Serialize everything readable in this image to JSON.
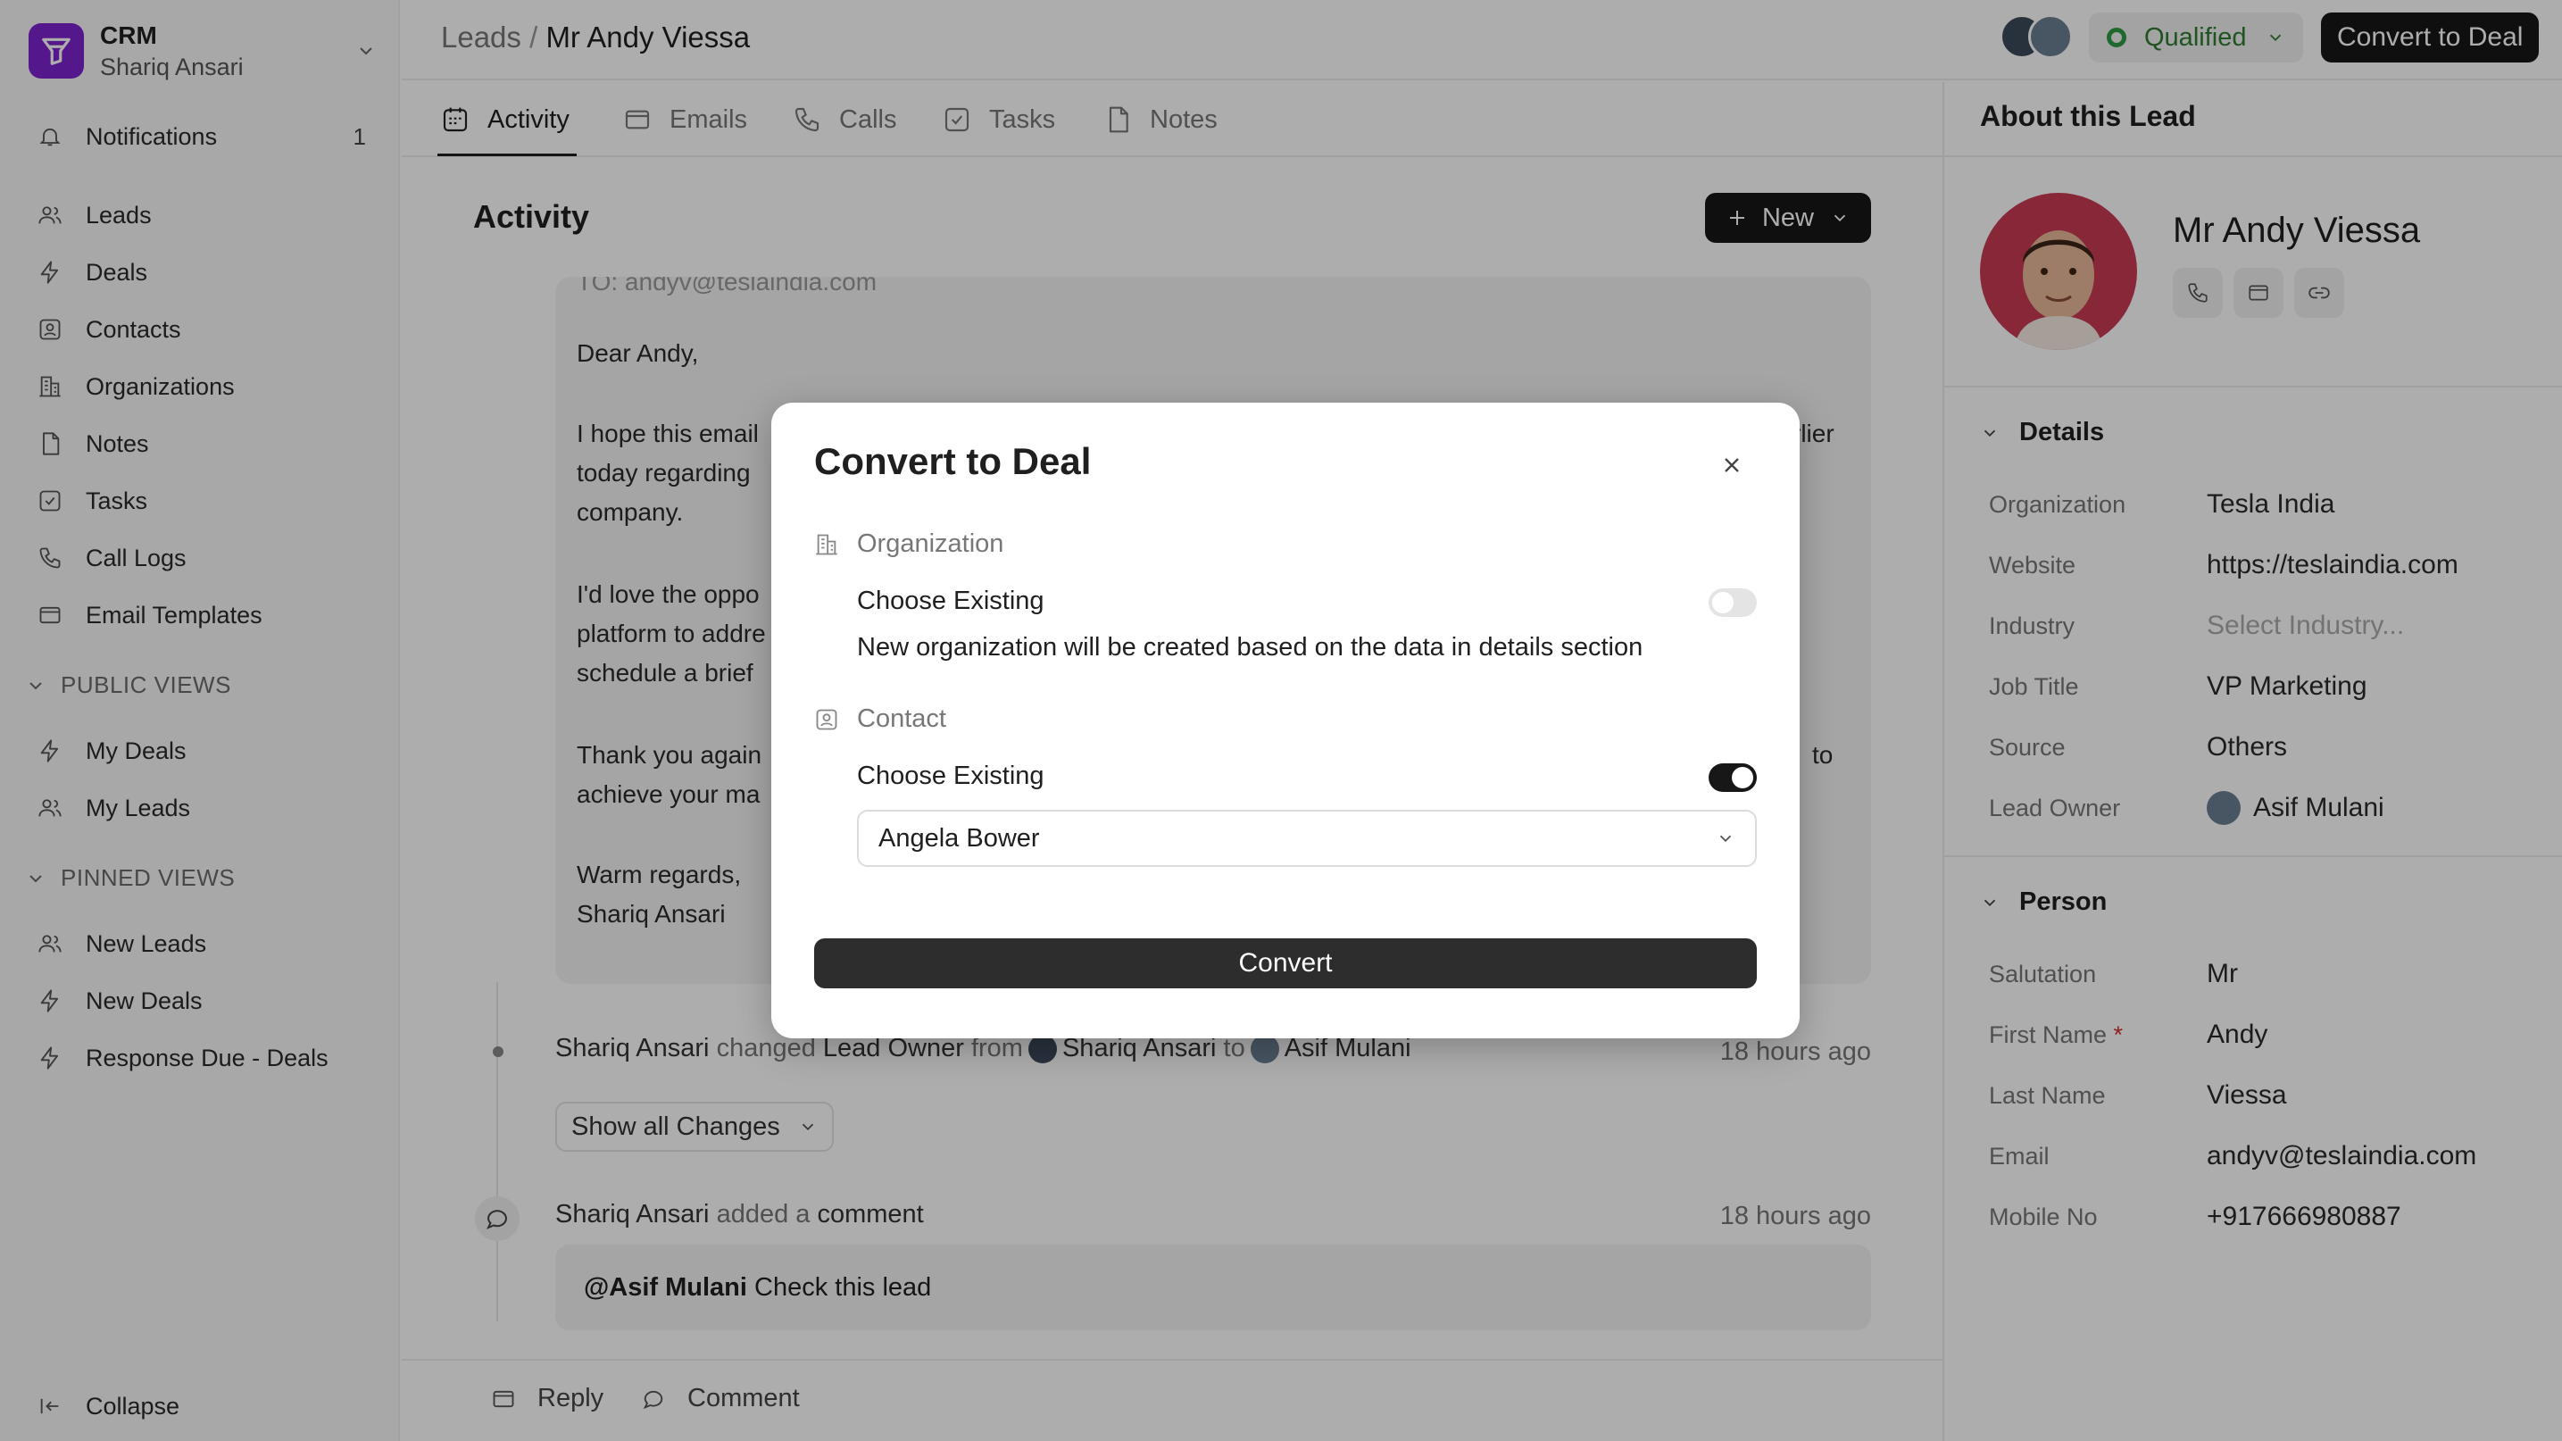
{
  "app": {
    "name": "CRM",
    "user": "Shariq Ansari"
  },
  "sidebar": {
    "notifications": {
      "label": "Notifications",
      "count": "1"
    },
    "items": [
      {
        "label": "Leads",
        "icon": "users-icon"
      },
      {
        "label": "Deals",
        "icon": "bolt-icon"
      },
      {
        "label": "Contacts",
        "icon": "contact-icon"
      },
      {
        "label": "Organizations",
        "icon": "building-icon"
      },
      {
        "label": "Notes",
        "icon": "note-icon"
      },
      {
        "label": "Tasks",
        "icon": "checkbox-icon"
      },
      {
        "label": "Call Logs",
        "icon": "phone-icon"
      },
      {
        "label": "Email Templates",
        "icon": "mail-icon"
      }
    ],
    "public_views": {
      "title": "PUBLIC VIEWS",
      "items": [
        "My Deals",
        "My Leads"
      ]
    },
    "pinned_views": {
      "title": "PINNED VIEWS",
      "items": [
        "New Leads",
        "New Deals",
        "Response Due - Deals"
      ]
    },
    "collapse": "Collapse"
  },
  "header": {
    "breadcrumb_parent": "Leads",
    "breadcrumb_sep": "/",
    "breadcrumb_current": "Mr Andy Viessa",
    "status": "Qualified",
    "convert_label": "Convert to Deal"
  },
  "tabs": [
    {
      "label": "Activity",
      "active": true
    },
    {
      "label": "Emails"
    },
    {
      "label": "Calls"
    },
    {
      "label": "Tasks"
    },
    {
      "label": "Notes"
    }
  ],
  "activity": {
    "title": "Activity",
    "new_label": "New",
    "email": {
      "to": "TO: andyv@teslaindia.com",
      "lines": [
        "Dear Andy,",
        "I hope this email",
        "today regarding",
        "company.",
        "I'd love the oppo",
        "platform to addre",
        "schedule a brief",
        "Thank you again",
        "achieve your ma",
        "Warm regards,",
        "Shariq Ansari"
      ],
      "right_fragments": [
        "rlier",
        "to"
      ]
    },
    "change": {
      "actor": "Shariq Ansari",
      "verb": "changed",
      "field": "Lead Owner",
      "from_word": "from",
      "from_user": "Shariq Ansari",
      "to_word": "to",
      "to_user": "Asif Mulani",
      "time": "18 hours ago",
      "show_changes": "Show all Changes"
    },
    "comment": {
      "actor": "Shariq Ansari",
      "verb": "added a",
      "noun": "comment",
      "time": "18 hours ago",
      "mention": "@Asif Mulani",
      "text": "Check this lead"
    }
  },
  "footer": {
    "reply": "Reply",
    "comment": "Comment"
  },
  "right_panel": {
    "title": "About this Lead",
    "name": "Mr Andy Viessa",
    "details": {
      "title": "Details",
      "fields": [
        {
          "label": "Organization",
          "value": "Tesla India"
        },
        {
          "label": "Website",
          "value": "https://teslaindia.com"
        },
        {
          "label": "Industry",
          "value": "Select Industry..."
        },
        {
          "label": "Job Title",
          "value": "VP Marketing"
        },
        {
          "label": "Source",
          "value": "Others"
        },
        {
          "label": "Lead Owner",
          "value": "Asif Mulani"
        }
      ]
    },
    "person": {
      "title": "Person",
      "fields": [
        {
          "label": "Salutation",
          "value": "Mr"
        },
        {
          "label": "First Name",
          "value": "Andy",
          "required": "*"
        },
        {
          "label": "Last Name",
          "value": "Viessa"
        },
        {
          "label": "Email",
          "value": "andyv@teslaindia.com"
        },
        {
          "label": "Mobile No",
          "value": "+917666980887"
        }
      ]
    }
  },
  "modal": {
    "title": "Convert to Deal",
    "organization": {
      "section": "Organization",
      "choose_label": "Choose Existing",
      "toggle_on": false,
      "note": "New organization will be created based on the data in details section"
    },
    "contact": {
      "section": "Contact",
      "choose_label": "Choose Existing",
      "toggle_on": true,
      "selected": "Angela Bower"
    },
    "convert_label": "Convert"
  },
  "colors": {
    "accent": "#171717",
    "brand": "#7e22ce",
    "qualified": "#2e9a44",
    "avatar_bg": "#c83a52"
  }
}
